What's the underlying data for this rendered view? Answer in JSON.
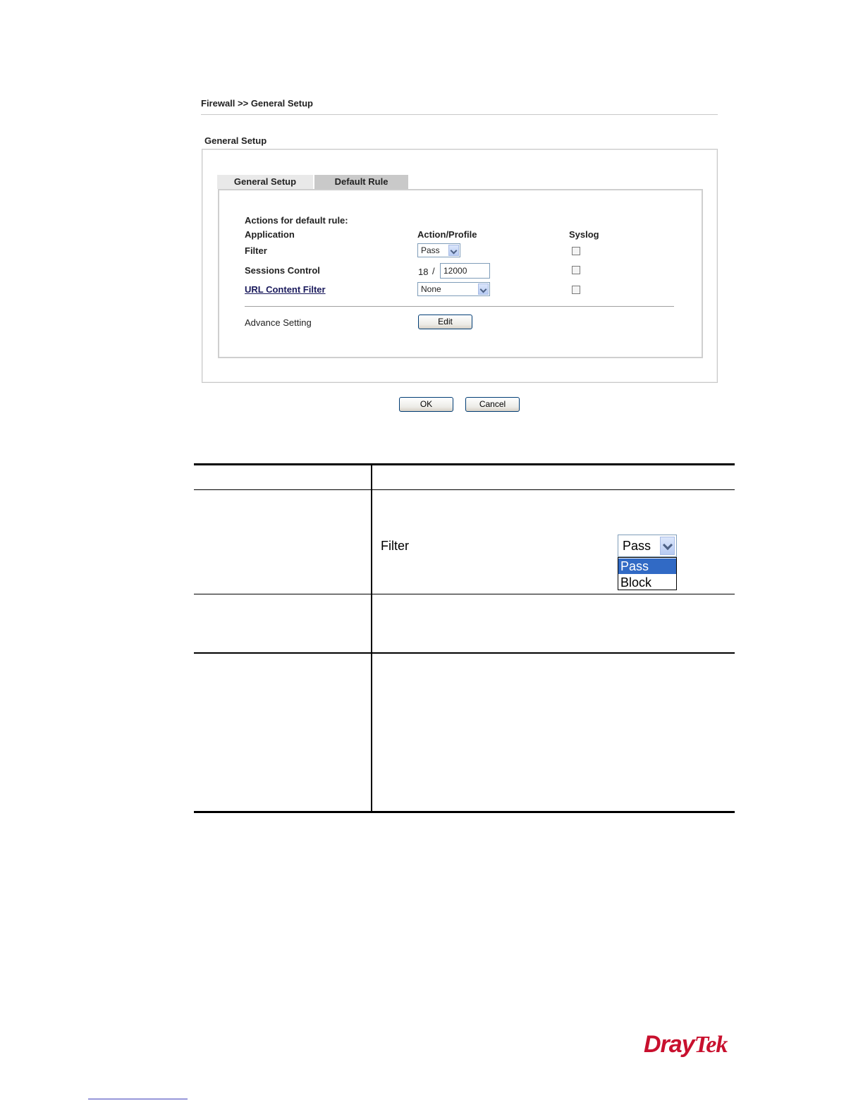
{
  "breadcrumb": "Firewall >> General Setup",
  "section_title": "General Setup",
  "tabs": [
    {
      "label": "General Setup"
    },
    {
      "label": "Default Rule"
    }
  ],
  "form": {
    "heading": "Actions for default rule:",
    "columns": {
      "application": "Application",
      "action": "Action/Profile",
      "syslog": "Syslog"
    },
    "rows": {
      "filter": {
        "label": "Filter",
        "value": "Pass"
      },
      "sessions": {
        "label": "Sessions Control",
        "current": "18",
        "separator": "/",
        "limit": "12000"
      },
      "url": {
        "label": "URL Content Filter",
        "value": "None"
      }
    },
    "advance": {
      "label": "Advance Setting",
      "button": "Edit"
    }
  },
  "buttons": {
    "ok": "OK",
    "cancel": "Cancel"
  },
  "description_table": {
    "filter_example": {
      "label": "Filter",
      "selected": "Pass",
      "options": [
        "Pass",
        "Block"
      ]
    }
  },
  "logo": {
    "part1": "Dray",
    "part2": "Tek"
  },
  "colors": {
    "brand": "#c8102e",
    "selected_option": "#316ac5"
  }
}
